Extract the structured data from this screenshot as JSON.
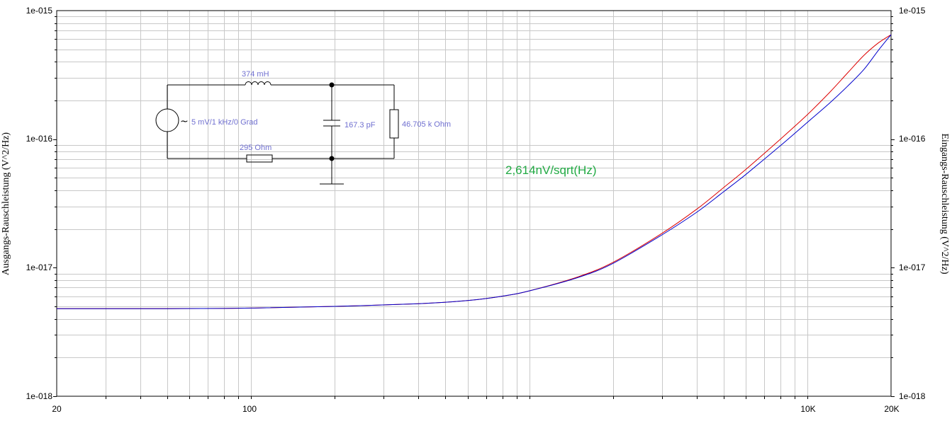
{
  "chart_data": {
    "type": "line",
    "x_scale": "log",
    "y_scale": "log",
    "xlim": [
      20,
      20000
    ],
    "ylim": [
      1e-18,
      1e-15
    ],
    "grid": true,
    "left_ylabel": "Ausgangs-Rauschleistung (V^2/Hz)",
    "right_ylabel": "Eingangs-Rauschleistung (V^2/Hz)",
    "x_ticks": [
      "20",
      "100",
      "10K",
      "20K"
    ],
    "y_ticks_left": [
      "1e-018",
      "1e-017",
      "1e-016",
      "1e-015"
    ],
    "y_ticks_right": [
      "1e-018",
      "1e-017",
      "1e-016",
      "1e-015"
    ],
    "annotation": "2,614nV/sqrt(Hz)",
    "series": [
      {
        "color": "#dd0000",
        "x": [
          20,
          50,
          100,
          200,
          400,
          600,
          800,
          1000,
          1500,
          2000,
          3000,
          4000,
          5000,
          6000,
          8000,
          10000,
          12000,
          14000,
          16000,
          18000,
          20000
        ],
        "y": [
          4.8e-18,
          4.8e-18,
          4.85e-18,
          5e-18,
          5.25e-18,
          5.55e-18,
          6e-18,
          6.6e-18,
          8.5e-18,
          1.1e-17,
          1.85e-17,
          2.85e-17,
          4.2e-17,
          5.8e-17,
          1e-16,
          1.55e-16,
          2.3e-16,
          3.3e-16,
          4.5e-16,
          5.6e-16,
          6.5e-16
        ]
      },
      {
        "color": "#0000cc",
        "x": [
          20,
          50,
          100,
          200,
          400,
          600,
          800,
          1000,
          1500,
          2000,
          3000,
          4000,
          5000,
          6000,
          8000,
          10000,
          12000,
          14000,
          16000,
          18000,
          20000
        ],
        "y": [
          4.8e-18,
          4.8e-18,
          4.85e-18,
          5e-18,
          5.25e-18,
          5.55e-18,
          6e-18,
          6.6e-18,
          8.4e-18,
          1.08e-17,
          1.8e-17,
          2.7e-17,
          3.9e-17,
          5.3e-17,
          8.9e-17,
          1.35e-16,
          1.9e-16,
          2.6e-16,
          3.5e-16,
          4.9e-16,
          6.5e-16
        ]
      }
    ]
  },
  "schematic": {
    "inductor_label": "374 mH",
    "source_label": "5 mV/1 kHz/0 Grad",
    "capacitor_label": "167.3 pF",
    "load_label": "46.705 k Ohm",
    "resistor_label": "295  Ohm",
    "source_symbol": "~"
  }
}
